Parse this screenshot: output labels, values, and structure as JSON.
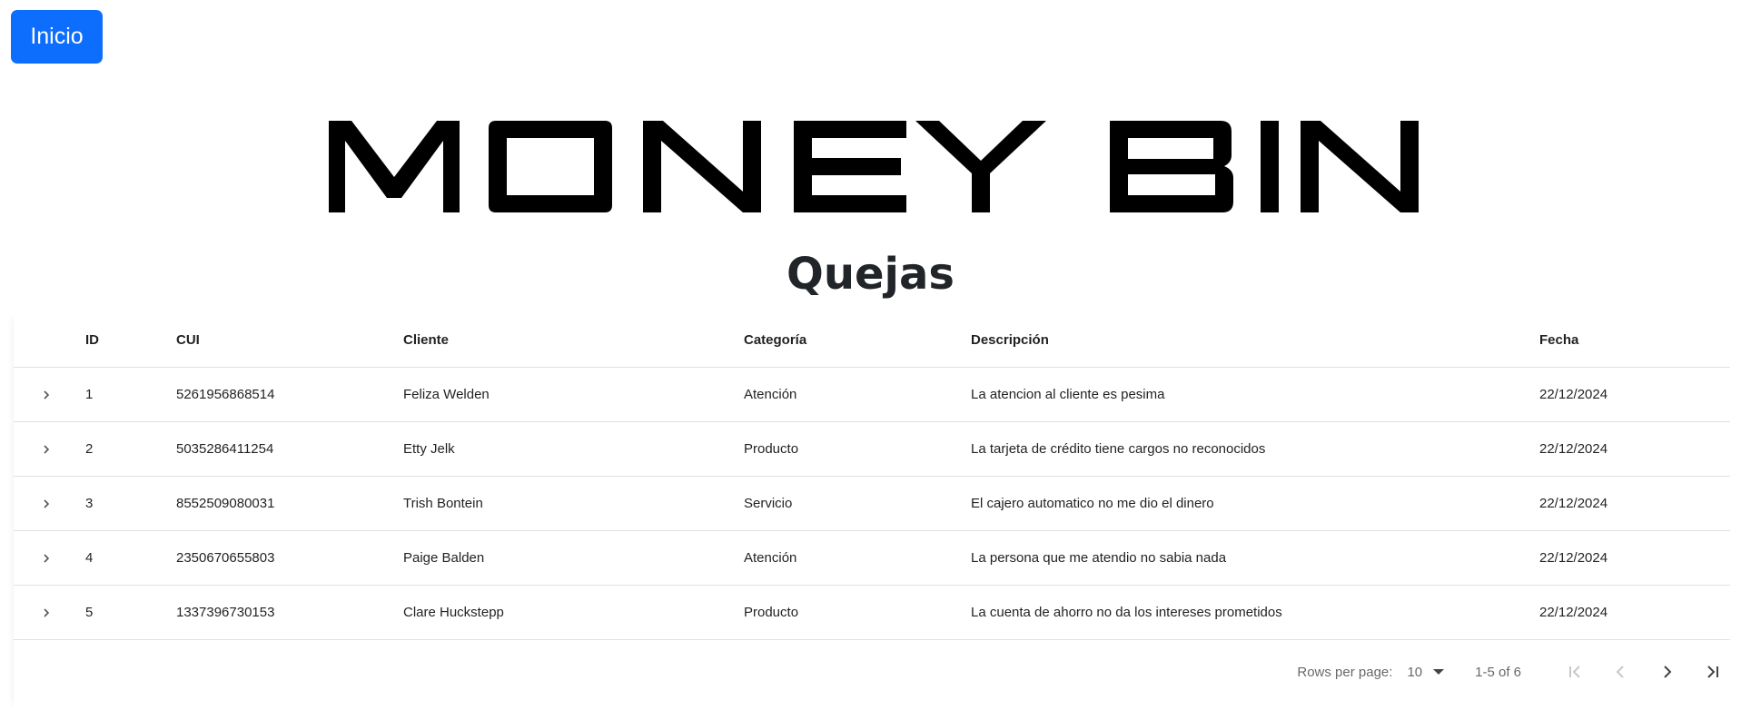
{
  "header": {
    "home_label": "Inicio",
    "logo_text": "MONEY BIN",
    "page_title": "Quejas"
  },
  "table": {
    "columns": [
      "ID",
      "CUI",
      "Cliente",
      "Categoría",
      "Descripción",
      "Fecha"
    ],
    "rows": [
      {
        "id": "1",
        "cui": "5261956868514",
        "cliente": "Feliza Welden",
        "categoria": "Atención",
        "descripcion": "La atencion al cliente es pesima",
        "fecha": "22/12/2024"
      },
      {
        "id": "2",
        "cui": "5035286411254",
        "cliente": "Etty Jelk",
        "categoria": "Producto",
        "descripcion": "La tarjeta de crédito tiene cargos no reconocidos",
        "fecha": "22/12/2024"
      },
      {
        "id": "3",
        "cui": "8552509080031",
        "cliente": "Trish Bontein",
        "categoria": "Servicio",
        "descripcion": "El cajero automatico no me dio el dinero",
        "fecha": "22/12/2024"
      },
      {
        "id": "4",
        "cui": "2350670655803",
        "cliente": "Paige Balden",
        "categoria": "Atención",
        "descripcion": "La persona que me atendio no sabia nada",
        "fecha": "22/12/2024"
      },
      {
        "id": "5",
        "cui": "1337396730153",
        "cliente": "Clare Huckstepp",
        "categoria": "Producto",
        "descripcion": "La cuenta de ahorro no da los intereses prometidos",
        "fecha": "22/12/2024"
      }
    ]
  },
  "pagination": {
    "rows_per_page_label": "Rows per page:",
    "rows_per_page_value": "10",
    "range_text": "1-5 of 6"
  },
  "icons": {
    "expand": "chevron-right-icon",
    "select_caret": "caret-down-icon",
    "first_page": "first-page-icon",
    "prev_page": "chevron-left-icon",
    "next_page": "chevron-right-icon",
    "last_page": "last-page-icon"
  },
  "colors": {
    "primary_button": "#0d6efd",
    "logo": "#000000"
  }
}
